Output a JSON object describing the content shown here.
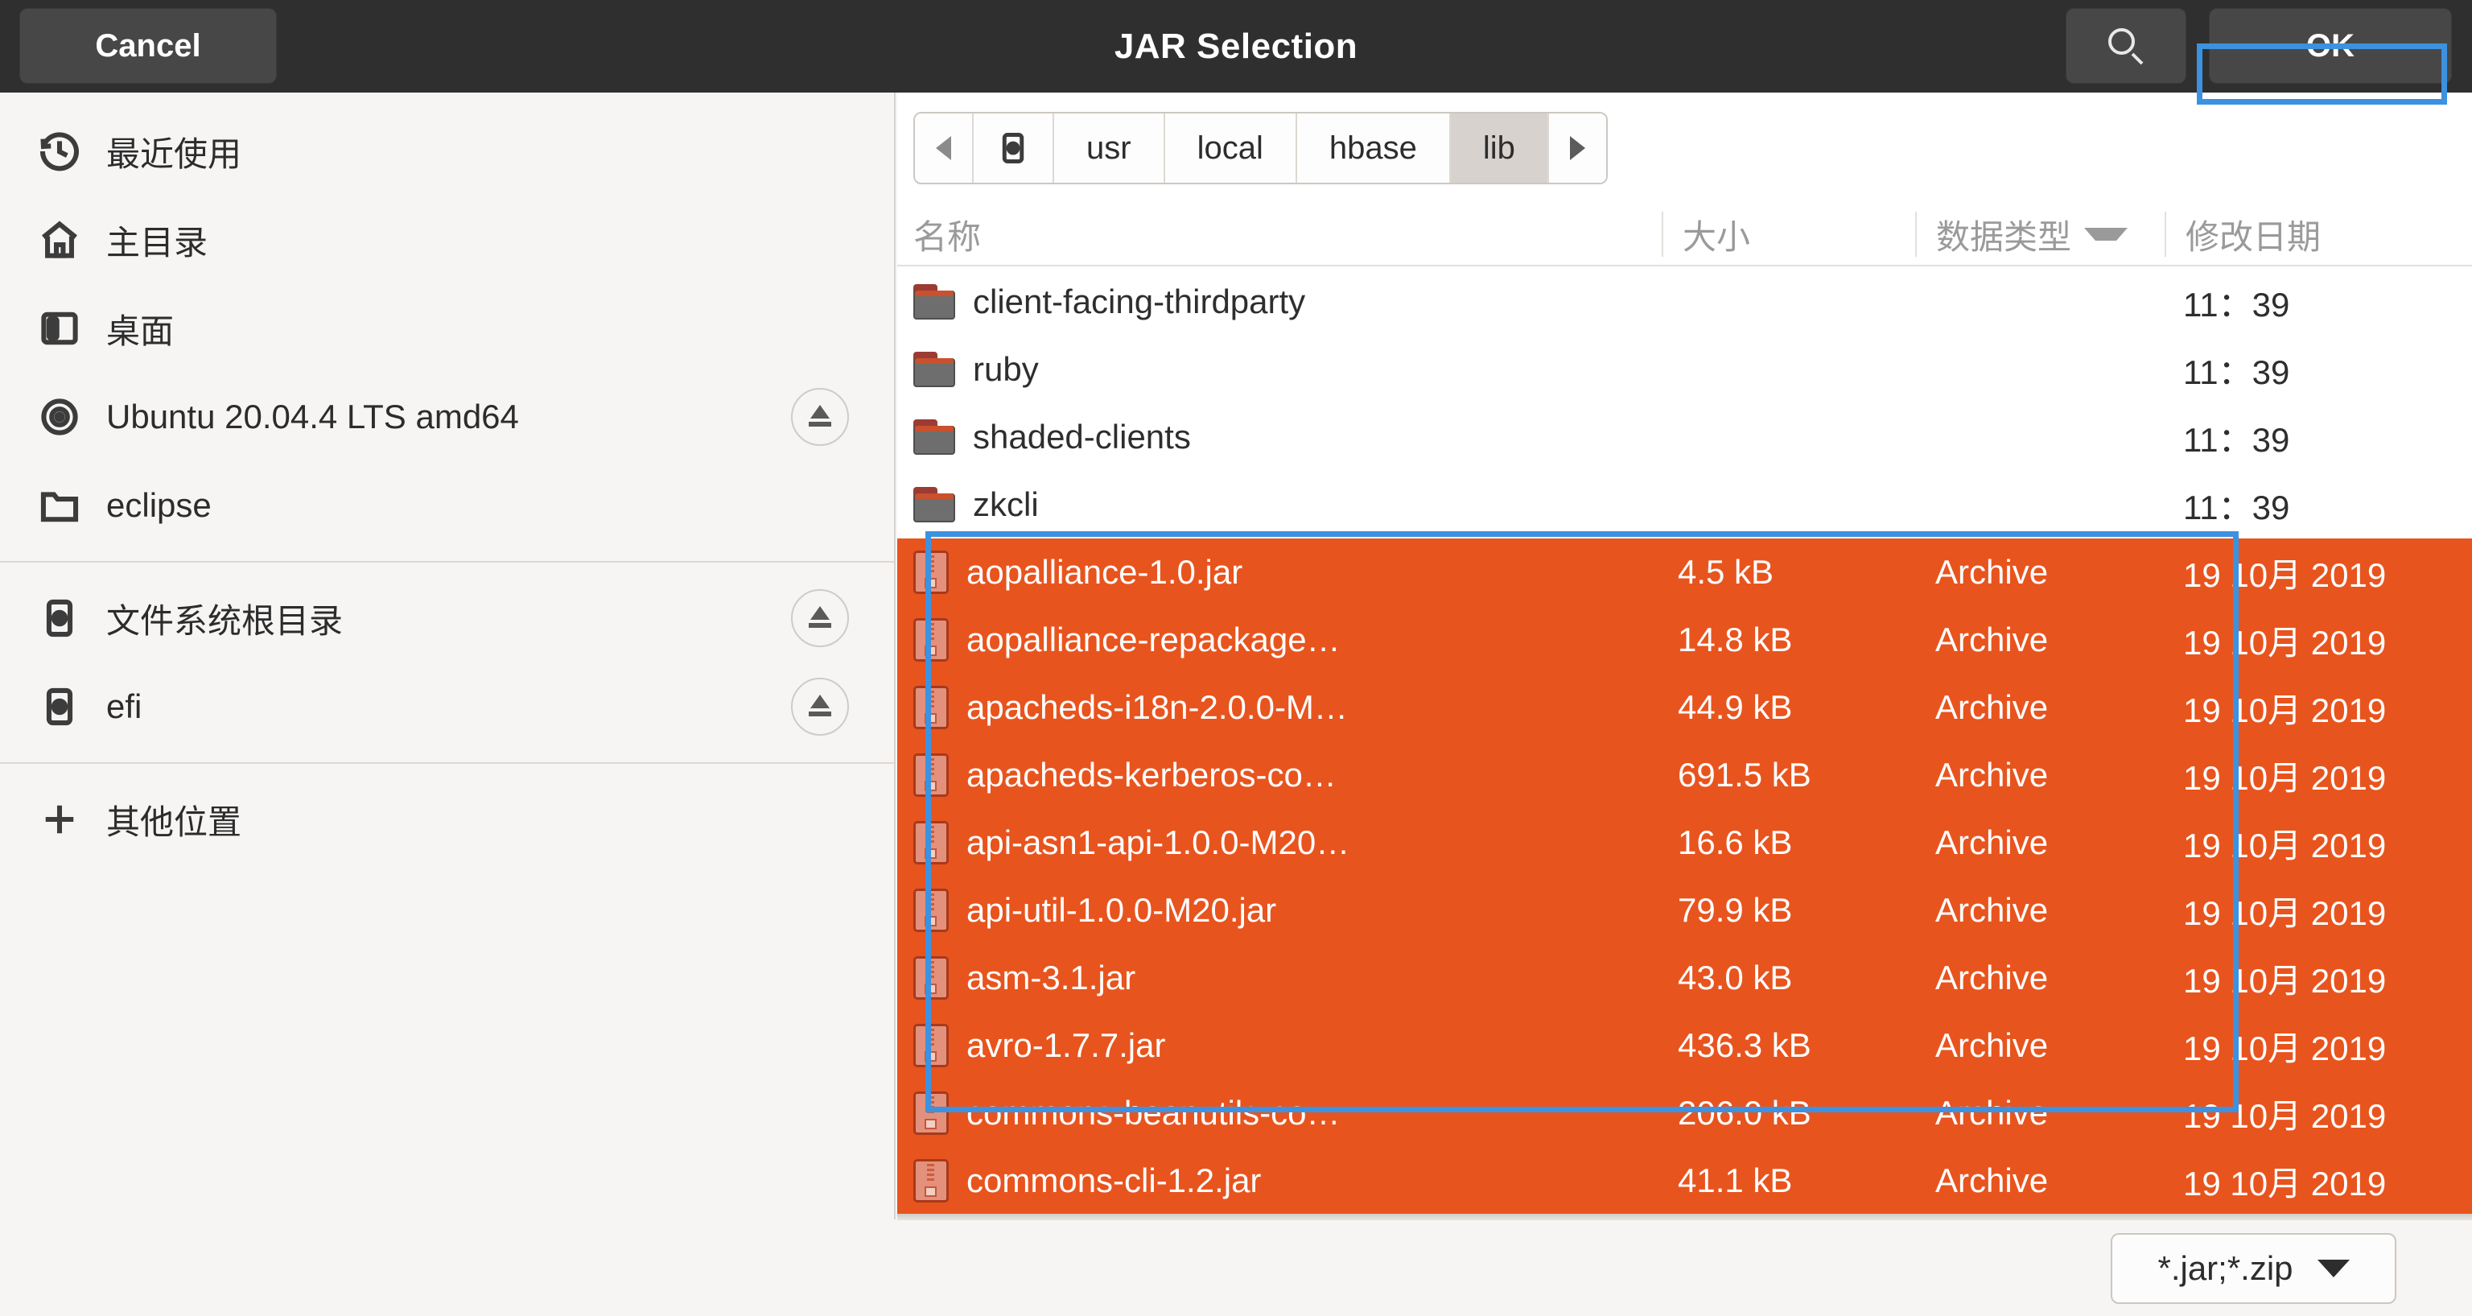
{
  "titlebar": {
    "cancel_label": "Cancel",
    "title": "JAR Selection",
    "ok_label": "OK",
    "search_icon": "search-icon"
  },
  "sidebar": {
    "groups": [
      {
        "items": [
          {
            "label": "最近使用",
            "icon": "recent-clock-icon",
            "eject": false
          },
          {
            "label": "主目录",
            "icon": "home-icon",
            "eject": false
          },
          {
            "label": "桌面",
            "icon": "desktop-icon",
            "eject": false
          },
          {
            "label": "Ubuntu 20.04.4 LTS amd64",
            "icon": "optical-disc-icon",
            "eject": true
          },
          {
            "label": "eclipse",
            "icon": "folder-icon",
            "eject": false
          }
        ]
      },
      {
        "items": [
          {
            "label": "文件系统根目录",
            "icon": "drive-icon",
            "eject": true
          },
          {
            "label": "efi",
            "icon": "drive-icon",
            "eject": true
          }
        ]
      },
      {
        "items": [
          {
            "label": "其他位置",
            "icon": "plus-icon",
            "eject": false
          }
        ]
      }
    ]
  },
  "pathbar": {
    "back_icon": "chevron-left-icon",
    "forward_icon": "chevron-right-icon",
    "root_icon": "drive-icon",
    "crumbs": [
      "usr",
      "local",
      "hbase",
      "lib"
    ],
    "active_crumb": "lib"
  },
  "columns": {
    "name": "名称",
    "size": "大小",
    "type": "数据类型",
    "modified": "修改日期",
    "sorted_by": "数据类型",
    "sort_caret": "chevron-down-icon"
  },
  "files": [
    {
      "name": "client-facing-thirdparty",
      "size": "",
      "type": "",
      "modified": "11：39",
      "kind": "folder",
      "selected": false
    },
    {
      "name": "ruby",
      "size": "",
      "type": "",
      "modified": "11：39",
      "kind": "folder",
      "selected": false
    },
    {
      "name": "shaded-clients",
      "size": "",
      "type": "",
      "modified": "11：39",
      "kind": "folder",
      "selected": false
    },
    {
      "name": "zkcli",
      "size": "",
      "type": "",
      "modified": "11：39",
      "kind": "folder",
      "selected": false
    },
    {
      "name": "aopalliance-1.0.jar",
      "size": "4.5 kB",
      "type": "Archive",
      "modified": "19 10月 2019",
      "kind": "archive",
      "selected": true
    },
    {
      "name": "aopalliance-repackage…",
      "size": "14.8 kB",
      "type": "Archive",
      "modified": "19 10月 2019",
      "kind": "archive",
      "selected": true
    },
    {
      "name": "apacheds-i18n-2.0.0-M…",
      "size": "44.9 kB",
      "type": "Archive",
      "modified": "19 10月 2019",
      "kind": "archive",
      "selected": true
    },
    {
      "name": "apacheds-kerberos-co…",
      "size": "691.5 kB",
      "type": "Archive",
      "modified": "19 10月 2019",
      "kind": "archive",
      "selected": true
    },
    {
      "name": "api-asn1-api-1.0.0-M20…",
      "size": "16.6 kB",
      "type": "Archive",
      "modified": "19 10月 2019",
      "kind": "archive",
      "selected": true
    },
    {
      "name": "api-util-1.0.0-M20.jar",
      "size": "79.9 kB",
      "type": "Archive",
      "modified": "19 10月 2019",
      "kind": "archive",
      "selected": true
    },
    {
      "name": "asm-3.1.jar",
      "size": "43.0 kB",
      "type": "Archive",
      "modified": "19 10月 2019",
      "kind": "archive",
      "selected": true
    },
    {
      "name": "avro-1.7.7.jar",
      "size": "436.3 kB",
      "type": "Archive",
      "modified": "19 10月 2019",
      "kind": "archive",
      "selected": true
    },
    {
      "name": "commons-beanutils-co…",
      "size": "206.0 kB",
      "type": "Archive",
      "modified": "19 10月 2019",
      "kind": "archive",
      "selected": true
    },
    {
      "name": "commons-cli-1.2.jar",
      "size": "41.1 kB",
      "type": "Archive",
      "modified": "19 10月 2019",
      "kind": "archive",
      "selected": true
    }
  ],
  "bottombar": {
    "filter_value": "*.jar;*.zip",
    "filter_caret": "chevron-down-icon"
  },
  "colors": {
    "selection_orange": "#e8541e",
    "titlebar_dark": "#2f2f2f",
    "annotation_blue": "#3c92e0",
    "sidebar_bg": "#f6f5f4"
  }
}
